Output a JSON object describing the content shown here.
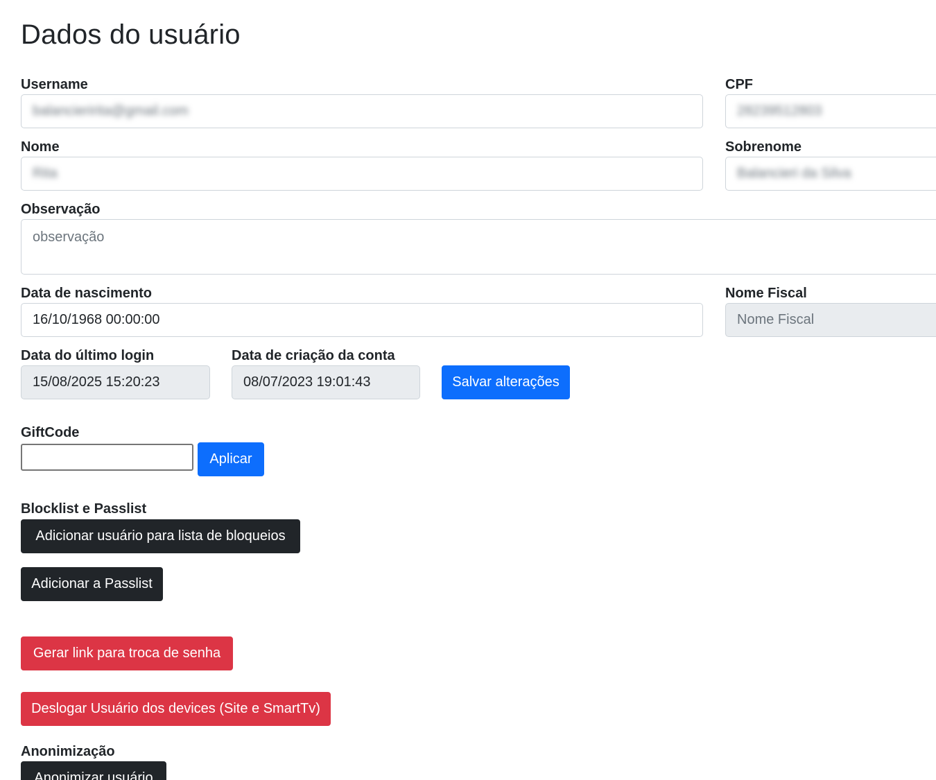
{
  "page": {
    "title": "Dados do usuário"
  },
  "fields": {
    "username": {
      "label": "Username",
      "value": "balancieririta@gmail.com"
    },
    "cpf": {
      "label": "CPF",
      "value": "28239512803"
    },
    "nome": {
      "label": "Nome",
      "value": "Rita"
    },
    "sobrenome": {
      "label": "Sobrenome",
      "value": "Balancieri da Silva"
    },
    "observacao": {
      "label": "Observação",
      "placeholder": "observação"
    },
    "data_nascimento": {
      "label": "Data de nascimento",
      "value": "16/10/1968 00:00:00"
    },
    "nome_fiscal": {
      "label": "Nome Fiscal",
      "placeholder": "Nome Fiscal"
    },
    "ultimo_login": {
      "label": "Data do último login",
      "value": "15/08/2025 15:20:23"
    },
    "criacao_conta": {
      "label": "Data de criação da conta",
      "value": "08/07/2023 19:01:43"
    }
  },
  "actions": {
    "save_label": "Salvar alterações"
  },
  "giftcode": {
    "label": "GiftCode",
    "value": "",
    "apply_label": "Aplicar"
  },
  "lists": {
    "section_label": "Blocklist e Passlist",
    "blocklist_button": "Adicionar usuário para lista de bloqueios",
    "passlist_button": "Adicionar a Passlist"
  },
  "security": {
    "reset_link_button": "Gerar link para troca de senha",
    "logout_button": "Deslogar Usuário dos devices (Site e SmartTv)"
  },
  "anon": {
    "section_label": "Anonimização",
    "button": "Anonimizar usuário"
  },
  "colors": {
    "primary": "#0d6efd",
    "dark": "#212529",
    "danger": "#dc3545",
    "readonly_bg": "#e9ecef"
  }
}
